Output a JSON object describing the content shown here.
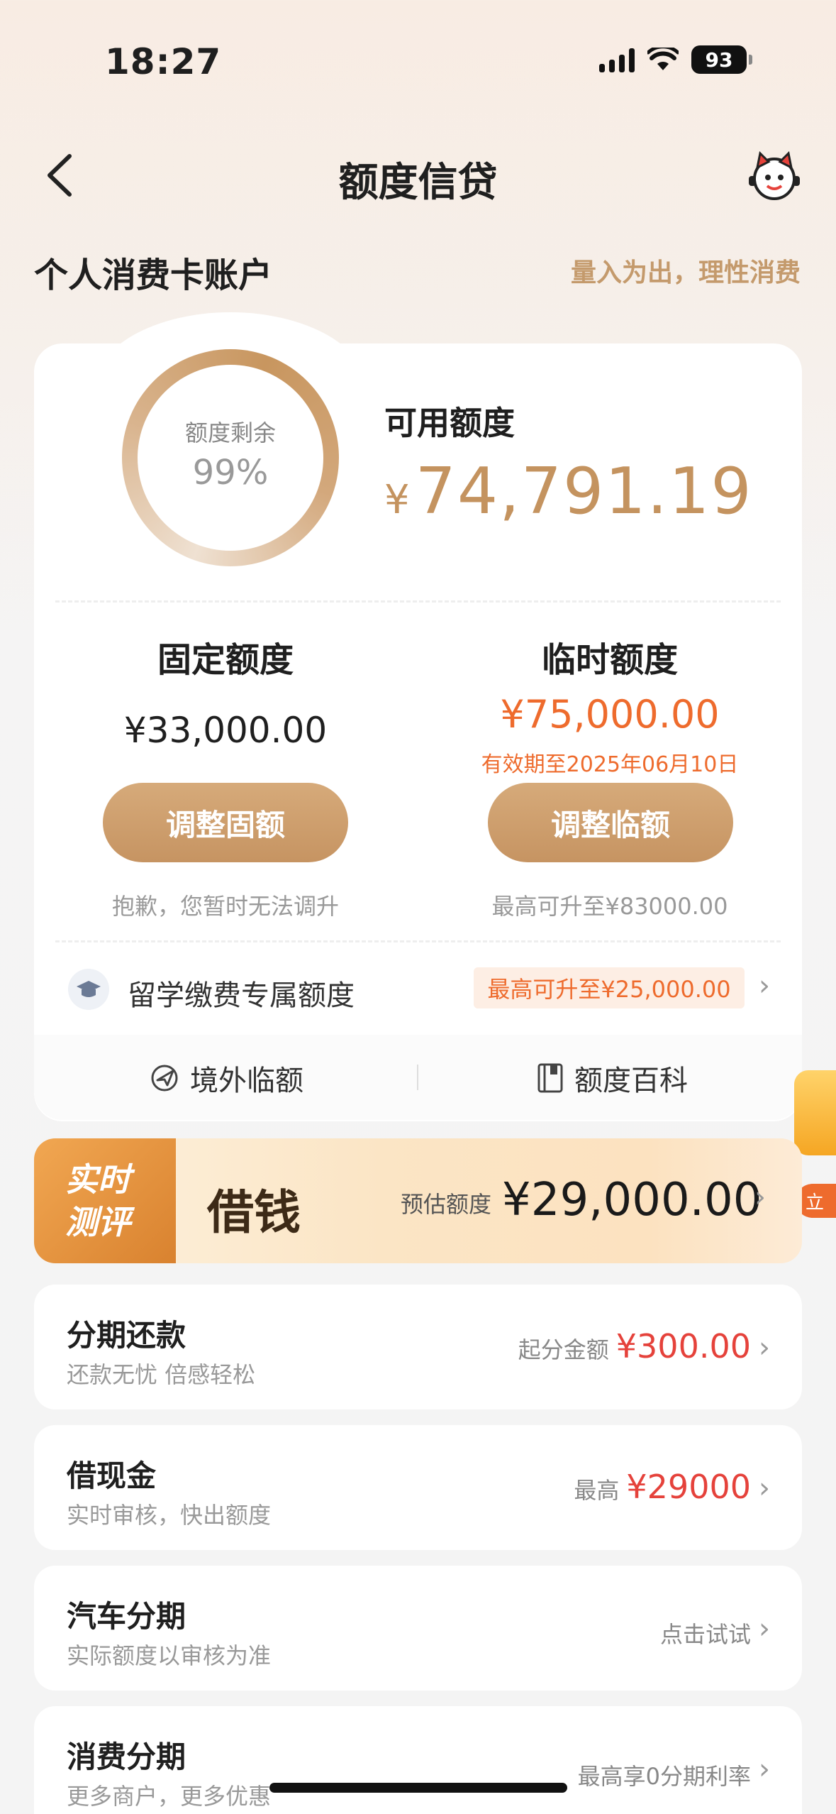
{
  "status_bar": {
    "time": "18:27",
    "battery": "93"
  },
  "nav": {
    "title": "额度信贷"
  },
  "section": {
    "title": "个人消费卡账户",
    "slogan": "量入为出，理性消费"
  },
  "quota": {
    "ring_label": "额度剩余",
    "ring_percent": "99%",
    "remaining_fraction": 0.99,
    "available_label": "可用额度",
    "available_currency": "¥",
    "available_amount": "74,791.19",
    "fixed": {
      "title": "固定额度",
      "amount": "¥33,000.00",
      "button": "调整固额",
      "note": "抱歉，您暂时无法调升"
    },
    "temporary": {
      "title": "临时额度",
      "amount": "¥75,000.00",
      "expire": "有效期至2025年06月10日",
      "button": "调整临额",
      "note": "最高可升至¥83000.00"
    },
    "study": {
      "label": "留学缴费专属额度",
      "tag": "最高可升至¥25,000.00"
    },
    "tools": {
      "overseas": "境外临额",
      "wiki": "额度百科"
    }
  },
  "loan_banner": {
    "tag_line1": "实时",
    "tag_line2": "测评",
    "title": "借钱",
    "estimate_label": "预估额度",
    "estimate_value": "¥29,000.00"
  },
  "float_badge": {
    "text": "立"
  },
  "list": [
    {
      "title": "分期还款",
      "subtitle": "还款无忧 倍感轻松",
      "right_label": "起分金额",
      "right_value": "¥300.00"
    },
    {
      "title": "借现金",
      "subtitle": "实时审核，快出额度",
      "right_label": "最高",
      "right_value": "¥29000"
    },
    {
      "title": "汽车分期",
      "subtitle": "实际额度以审核为准",
      "right_label": "点击试试",
      "right_value": ""
    },
    {
      "title": "消费分期",
      "subtitle": "更多商户，更多优惠",
      "right_label": "最高享0分期利率",
      "right_value": ""
    }
  ],
  "colors": {
    "accent_gold": "#c4935f",
    "orange": "#ee6b2d",
    "red": "#e5423b"
  }
}
